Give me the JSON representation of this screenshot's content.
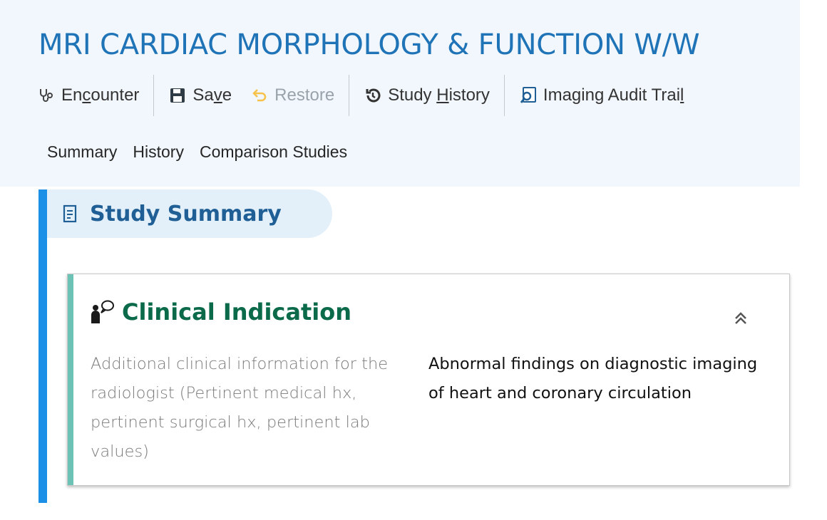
{
  "page": {
    "title": "MRI CARDIAC MORPHOLOGY & FUNCTION W/W"
  },
  "toolbar": {
    "encounter": {
      "pre": "En",
      "hot": "c",
      "post": "ounter",
      "icon": "stethoscope-icon"
    },
    "save": {
      "pre": "Sa",
      "hot": "v",
      "post": "e",
      "icon": "floppy-disk-icon"
    },
    "restore": {
      "label": "Restore",
      "icon": "undo-arrow-icon",
      "disabled": true
    },
    "study_history": {
      "pre": "Study ",
      "hot": "H",
      "post": "istory",
      "icon": "history-clock-icon"
    },
    "imaging_audit_trail": {
      "pre": "Imaging Audit Trai",
      "hot": "l",
      "post": "",
      "icon": "audit-magnifier-icon"
    }
  },
  "tabs": [
    {
      "label": "Summary"
    },
    {
      "label": "History"
    },
    {
      "label": "Comparison Studies"
    }
  ],
  "section": {
    "title": "Study Summary",
    "icon": "document-icon"
  },
  "card": {
    "title": "Clinical Indication",
    "icon": "person-speech-icon",
    "collapse_icon": "double-chevron-up-icon",
    "field_label": "Additional clinical information for the radiologist (Pertinent medical hx, pertinent surgical hx, pertinent lab values)",
    "field_value": "Abnormal findings on diagnostic imaging of heart and coronary circulation"
  },
  "colors": {
    "title_blue": "#1f73b7",
    "section_bar": "#1c90e6",
    "card_accent": "#6cc2b4",
    "card_title_green": "#0b6a4a"
  }
}
